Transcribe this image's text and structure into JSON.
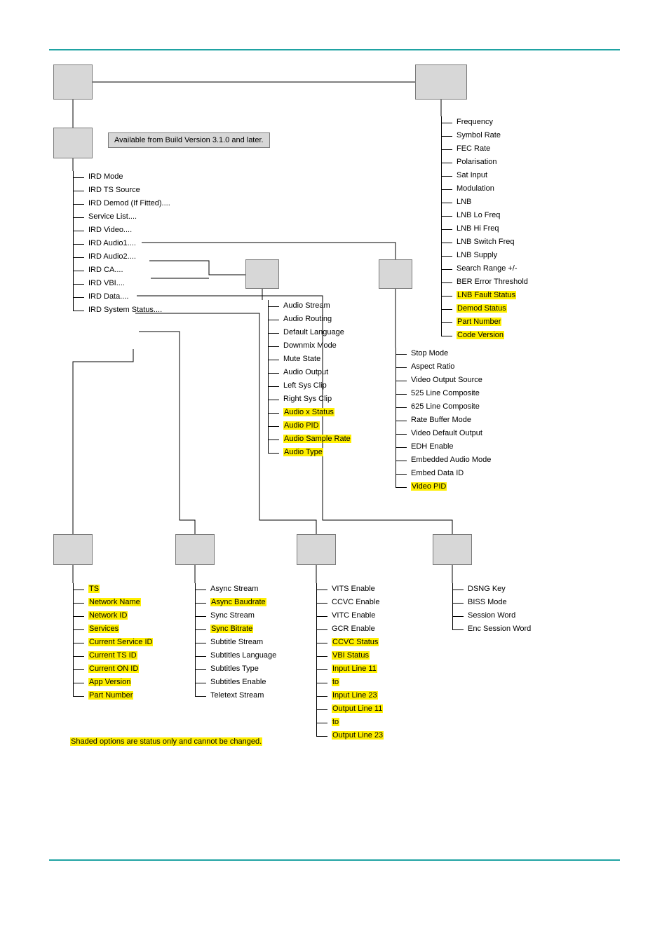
{
  "notes": {
    "build": "Available from Build Version 3.1.0 and later.",
    "shaded": "Shaded options are status only and cannot be changed."
  },
  "ird_root": [
    {
      "t": "IRD Mode"
    },
    {
      "t": "IRD TS Source"
    },
    {
      "t": "IRD Demod (If Fitted)...."
    },
    {
      "t": "Service List...."
    },
    {
      "t": "IRD Video...."
    },
    {
      "t": "IRD Audio1...."
    },
    {
      "t": "IRD Audio2...."
    },
    {
      "t": "IRD CA...."
    },
    {
      "t": "IRD VBI...."
    },
    {
      "t": "IRD Data...."
    },
    {
      "t": "IRD System Status...."
    }
  ],
  "demod": [
    {
      "t": "Frequency"
    },
    {
      "t": "Symbol Rate"
    },
    {
      "t": "FEC Rate"
    },
    {
      "t": "Polarisation"
    },
    {
      "t": "Sat Input"
    },
    {
      "t": "Modulation"
    },
    {
      "t": "LNB"
    },
    {
      "t": "LNB Lo Freq"
    },
    {
      "t": "LNB Hi Freq"
    },
    {
      "t": "LNB Switch Freq"
    },
    {
      "t": "LNB Supply"
    },
    {
      "t": "Search Range  +/-"
    },
    {
      "t": "BER Error Threshold"
    },
    {
      "t": "LNB Fault Status",
      "hl": true
    },
    {
      "t": "Demod Status",
      "hl": true
    },
    {
      "t": "Part Number",
      "hl": true
    },
    {
      "t": "Code Version",
      "hl": true
    }
  ],
  "audio": [
    {
      "t": "Audio Stream"
    },
    {
      "t": "Audio Routing"
    },
    {
      "t": "Default Language"
    },
    {
      "t": "Downmix Mode"
    },
    {
      "t": "Mute State"
    },
    {
      "t": "Audio Output"
    },
    {
      "t": "Left Sys Clip"
    },
    {
      "t": "Right Sys Clip"
    },
    {
      "t": "Audio x Status",
      "hl": true
    },
    {
      "t": "Audio PID",
      "hl": true
    },
    {
      "t": "Audio Sample Rate",
      "hl": true
    },
    {
      "t": "Audio Type",
      "hl": true
    }
  ],
  "video": [
    {
      "t": "Stop Mode"
    },
    {
      "t": "Aspect Ratio"
    },
    {
      "t": "Video Output Source"
    },
    {
      "t": "525 Line Composite"
    },
    {
      "t": "625 Line Composite"
    },
    {
      "t": "Rate Buffer Mode"
    },
    {
      "t": "Video Default Output"
    },
    {
      "t": "EDH Enable"
    },
    {
      "t": "Embedded Audio Mode"
    },
    {
      "t": "Embed Data ID"
    },
    {
      "t": "Video PID",
      "hl": true
    }
  ],
  "sysstatus": [
    {
      "t": "TS",
      "hl": true
    },
    {
      "t": "Network Name",
      "hl": true
    },
    {
      "t": "Network ID",
      "hl": true
    },
    {
      "t": "Services",
      "hl": true
    },
    {
      "t": "Current Service ID",
      "hl": true
    },
    {
      "t": "Current TS ID",
      "hl": true
    },
    {
      "t": "Current ON ID",
      "hl": true
    },
    {
      "t": "App Version",
      "hl": true
    },
    {
      "t": "Part Number",
      "hl": true
    }
  ],
  "data": [
    {
      "t": "Async Stream"
    },
    {
      "t": "Async Baudrate",
      "hl": true
    },
    {
      "t": "Sync Stream"
    },
    {
      "t": "Sync Bitrate",
      "hl": true
    },
    {
      "t": "Subtitle Stream"
    },
    {
      "t": "Subtitles Language"
    },
    {
      "t": "Subtitles Type"
    },
    {
      "t": "Subtitles Enable"
    },
    {
      "t": "Teletext Stream"
    }
  ],
  "vbi": [
    {
      "t": "VITS Enable"
    },
    {
      "t": "CCVC Enable"
    },
    {
      "t": "VITC Enable"
    },
    {
      "t": "GCR Enable"
    },
    {
      "t": "CCVC Status",
      "hl": true
    },
    {
      "t": "VBI Status",
      "hl": true
    },
    {
      "t": "Input Line 11",
      "hl": true
    },
    {
      "t": "to",
      "hl": true
    },
    {
      "t": "Input Line 23",
      "hl": true
    },
    {
      "t": "Output Line 11",
      "hl": true
    },
    {
      "t": "to",
      "hl": true
    },
    {
      "t": "Output Line 23",
      "hl": true
    }
  ],
  "ca": [
    {
      "t": "DSNG Key"
    },
    {
      "t": "BISS Mode"
    },
    {
      "t": "Session Word"
    },
    {
      "t": "Enc Session Word"
    }
  ]
}
